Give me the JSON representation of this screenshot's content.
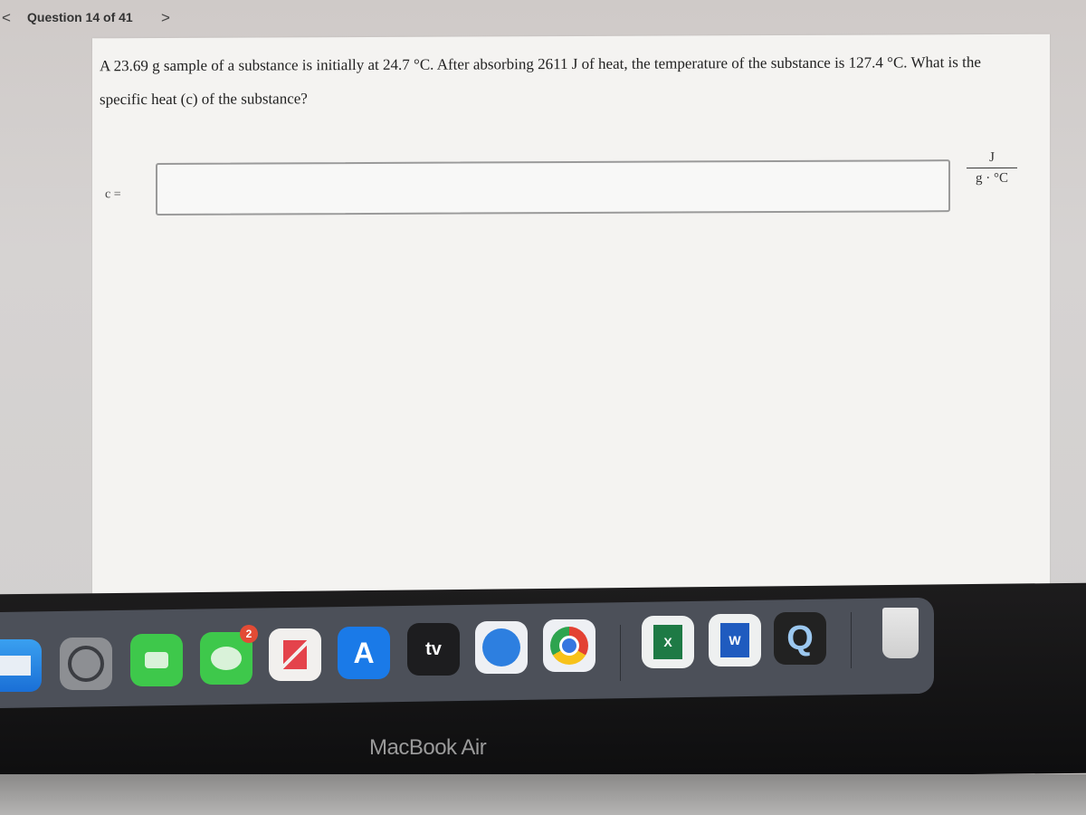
{
  "header": {
    "question_label": "Question 14 of 41",
    "prev_icon": "chevron-left-icon",
    "next_icon": "chevron-right-icon",
    "prev_glyph": "<",
    "next_glyph": ">"
  },
  "question": {
    "text": "A 23.69 g sample of a substance is initially at 24.7 °C. After absorbing 2611 J of heat, the temperature of the substance is 127.4 °C. What is the specific heat (c) of the substance?",
    "answer_label": "c =",
    "answer_value": "",
    "unit_numerator": "J",
    "unit_denominator": "g · °C"
  },
  "dock": {
    "apps": [
      {
        "name": "Mail",
        "icon": "mail-icon"
      },
      {
        "name": "System Preferences",
        "icon": "settings-icon"
      },
      {
        "name": "FaceTime",
        "icon": "facetime-icon"
      },
      {
        "name": "Messages",
        "icon": "messages-icon",
        "badge": "2"
      },
      {
        "name": "News",
        "icon": "news-icon"
      },
      {
        "name": "App Store",
        "icon": "app-store-icon",
        "glyph": "A"
      },
      {
        "name": "Apple TV",
        "icon": "apple-tv-icon",
        "glyph": "tv"
      },
      {
        "name": "Safari",
        "icon": "safari-icon"
      },
      {
        "name": "Chrome",
        "icon": "chrome-icon"
      },
      {
        "name": "Excel",
        "icon": "excel-icon",
        "glyph": "X"
      },
      {
        "name": "Word",
        "icon": "word-icon",
        "glyph": "W"
      },
      {
        "name": "QuickTime",
        "icon": "quicktime-icon",
        "glyph": "Q"
      },
      {
        "name": "Trash",
        "icon": "trash-icon"
      }
    ]
  },
  "device": {
    "label": "MacBook Air"
  }
}
